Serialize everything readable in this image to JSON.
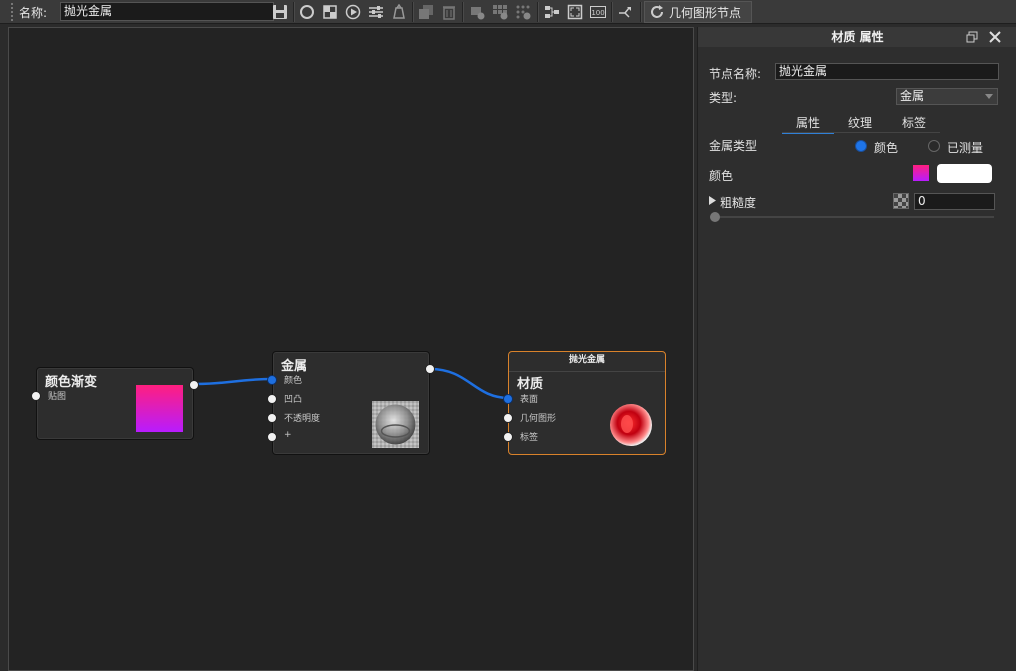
{
  "toolbar": {
    "name_label": "名称:",
    "name_value": "抛光金属",
    "geometry_button": "几何图形节点"
  },
  "nodes": {
    "gradient": {
      "title": "颜色渐变",
      "inputs": [
        "贴图"
      ],
      "preview_colors": [
        "#ff1f7f",
        "#b81cff"
      ]
    },
    "metal": {
      "title": "金属",
      "inputs": [
        "颜色",
        "凹凸",
        "不透明度",
        "+"
      ]
    },
    "material": {
      "header": "抛光金属",
      "title": "材质",
      "inputs": [
        "表面",
        "几何图形",
        "标签"
      ]
    }
  },
  "panel": {
    "title": "材质 属性",
    "node_name_label": "节点名称:",
    "node_name_value": "抛光金属",
    "type_label": "类型:",
    "type_value": "金属",
    "tabs": [
      "属性",
      "纹理",
      "标签"
    ],
    "active_tab": "属性",
    "metal_type_label": "金属类型",
    "radio_color": "颜色",
    "radio_measured": "已测量",
    "color_label": "颜色",
    "roughness_label": "粗糙度",
    "roughness_value": "0",
    "roughness_slider": 0
  },
  "colors": {
    "wire": "#1e6fe0",
    "selected_border": "#d9822b",
    "accent": "#2f80d8"
  }
}
